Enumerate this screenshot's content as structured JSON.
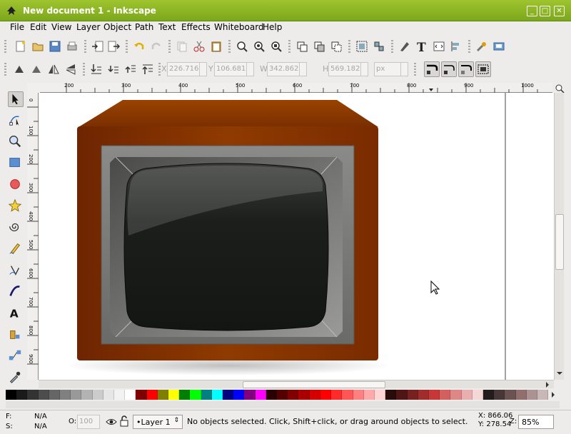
{
  "window": {
    "title": "New document 1 - Inkscape",
    "controls": [
      "_",
      "□",
      "✕"
    ]
  },
  "menu": [
    "File",
    "Edit",
    "View",
    "Layer",
    "Object",
    "Path",
    "Text",
    "Effects",
    "Whiteboard",
    "Help"
  ],
  "tool_controls": {
    "x_label": "X",
    "x_value": "226.716",
    "y_label": "Y",
    "y_value": "106.681",
    "w_label": "W",
    "w_value": "342.862",
    "h_label": "H",
    "h_value": "569.182",
    "unit": "px"
  },
  "ruler": {
    "h_labels": [
      "200",
      "300",
      "400",
      "500",
      "600",
      "700",
      "800",
      "900",
      "1000"
    ],
    "v_labels": [
      "0",
      "100",
      "200",
      "300",
      "400",
      "500",
      "600",
      "700",
      "800",
      "900"
    ]
  },
  "palette": [
    "#000000",
    "#1a1a1a",
    "#333333",
    "#4d4d4d",
    "#666666",
    "#808080",
    "#999999",
    "#b3b3b3",
    "#cccccc",
    "#e6e6e6",
    "#f2f2f2",
    "#ffffff",
    "#800000",
    "#ff0000",
    "#808000",
    "#ffff00",
    "#008000",
    "#00ff00",
    "#008080",
    "#00ffff",
    "#000080",
    "#0000ff",
    "#800080",
    "#ff00ff",
    "#2b0000",
    "#550000",
    "#800000",
    "#aa0000",
    "#d40000",
    "#ff0000",
    "#ff2a2a",
    "#ff5555",
    "#ff8080",
    "#ffaaaa",
    "#ffd5d5",
    "#280b0b",
    "#501616",
    "#782121",
    "#a02c2c",
    "#c83737",
    "#d35f5f",
    "#de8787",
    "#e9afaf",
    "#f4d7d7",
    "#241c1c",
    "#483737",
    "#6c5353",
    "#916f6f",
    "#ac9393",
    "#c8b7b7"
  ],
  "status": {
    "fill_label": "F:",
    "fill_value": "N/A",
    "stroke_label": "S:",
    "stroke_value": "N/A",
    "opacity_label": "O:",
    "opacity_value": "100",
    "layer": "•Layer 1",
    "message": "No objects selected. Click, Shift+click, or drag around objects to select.",
    "x_coord": "X: 866.06",
    "y_coord": "Y: 278.54",
    "zoom_label": "Z:",
    "zoom_value": "85%"
  },
  "colors": {
    "titlebar": "#8db827",
    "tv_cabinet": "#8a3300",
    "tv_bezel": "#7a7a78",
    "screen": "#1a1c1a"
  }
}
